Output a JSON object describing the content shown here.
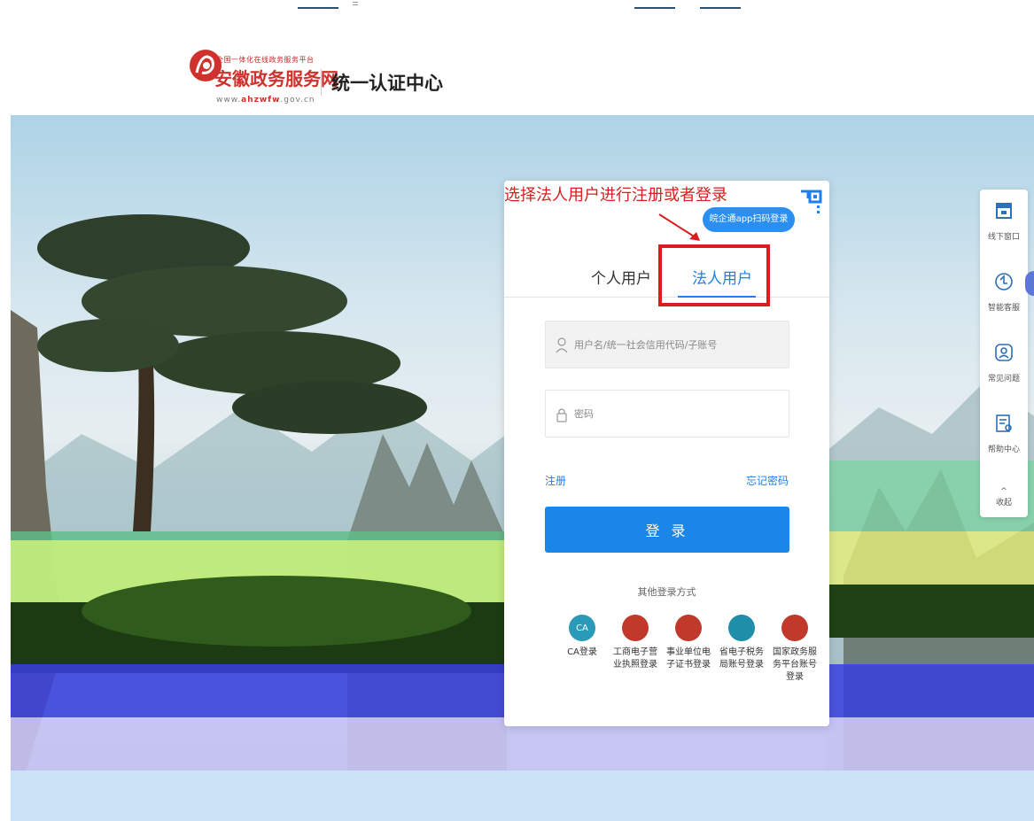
{
  "header": {
    "logo_small_text": "全国一体化在线政务服务平台",
    "logo_name": "安徽政务服务网",
    "logo_url_prefix": "www.",
    "logo_url_bold": "ahzwfw",
    "logo_url_suffix": ".gov.cn",
    "auth_center_title": "统一认证中心"
  },
  "annotation": {
    "text": "选择法人用户进行注册或者登录"
  },
  "login_card": {
    "scan_login_label": "皖企通app扫码登录",
    "tabs": [
      {
        "label": "个人用户",
        "active": false
      },
      {
        "label": "法人用户",
        "active": true
      }
    ],
    "username_placeholder": "用户名/统一社会信用代码/子账号",
    "password_placeholder": "密码",
    "register_label": "注册",
    "forgot_password_label": "忘记密码",
    "login_button_label": "登 录",
    "other_login_title": "其他登录方式",
    "other_logins": [
      {
        "icon_text": "CA",
        "label": "CA登录",
        "color": "#2a9ab8"
      },
      {
        "icon_text": "",
        "label": "工商电子营业执照登录",
        "color": "#c0392b"
      },
      {
        "icon_text": "",
        "label": "事业单位电子证书登录",
        "color": "#c0392b"
      },
      {
        "icon_text": "",
        "label": "省电子税务局账号登录",
        "color": "#1e8fa8"
      },
      {
        "icon_text": "",
        "label": "国家政务服务平台账号登录",
        "color": "#c0392b"
      }
    ]
  },
  "side_toolbar": {
    "items": [
      {
        "label": "线下窗口",
        "icon": "window-icon"
      },
      {
        "label": "智能客服",
        "icon": "robot-icon"
      },
      {
        "label": "常见问题",
        "icon": "faq-icon"
      },
      {
        "label": "帮助中心",
        "icon": "help-doc-icon"
      }
    ],
    "collapse_label": "收起"
  },
  "colors": {
    "brand_red": "#d0312d",
    "primary_blue": "#1a86e8",
    "annotation_red": "#d81e1e"
  }
}
